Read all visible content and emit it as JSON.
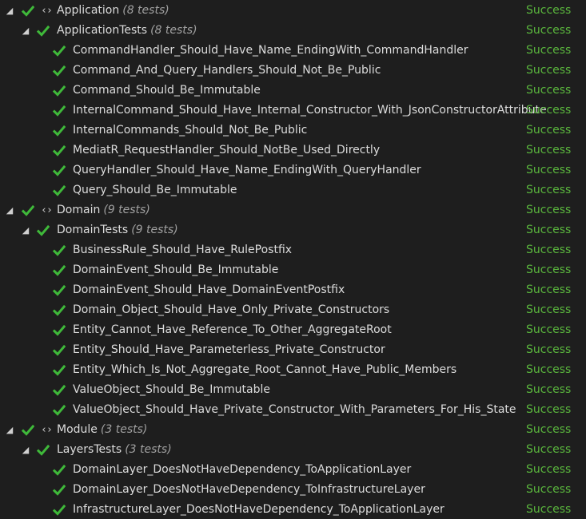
{
  "colors": {
    "background": "#1e1e1e",
    "text": "#dcdcdc",
    "success": "#5ab63d",
    "check_icon": "#3fb93a"
  },
  "icons": {
    "expander": "collapse-triangle-icon",
    "passed": "check-icon",
    "namespace": "namespace-braces-icon"
  },
  "tree": [
    {
      "level": 0,
      "type": "namespace",
      "name": "Application",
      "count": "(8 tests)",
      "status": "Success"
    },
    {
      "level": 1,
      "type": "class",
      "name": "ApplicationTests",
      "count": "(8 tests)",
      "status": "Success"
    },
    {
      "level": 2,
      "type": "test",
      "name": "CommandHandler_Should_Have_Name_EndingWith_CommandHandler",
      "status": "Success"
    },
    {
      "level": 2,
      "type": "test",
      "name": "Command_And_Query_Handlers_Should_Not_Be_Public",
      "status": "Success"
    },
    {
      "level": 2,
      "type": "test",
      "name": "Command_Should_Be_Immutable",
      "status": "Success"
    },
    {
      "level": 2,
      "type": "test",
      "name": "InternalCommand_Should_Have_Internal_Constructor_With_JsonConstructorAttribute",
      "status": "Success"
    },
    {
      "level": 2,
      "type": "test",
      "name": "InternalCommands_Should_Not_Be_Public",
      "status": "Success"
    },
    {
      "level": 2,
      "type": "test",
      "name": "MediatR_RequestHandler_Should_NotBe_Used_Directly",
      "status": "Success"
    },
    {
      "level": 2,
      "type": "test",
      "name": "QueryHandler_Should_Have_Name_EndingWith_QueryHandler",
      "status": "Success"
    },
    {
      "level": 2,
      "type": "test",
      "name": "Query_Should_Be_Immutable",
      "status": "Success"
    },
    {
      "level": 0,
      "type": "namespace",
      "name": "Domain",
      "count": "(9 tests)",
      "status": "Success"
    },
    {
      "level": 1,
      "type": "class",
      "name": "DomainTests",
      "count": "(9 tests)",
      "status": "Success"
    },
    {
      "level": 2,
      "type": "test",
      "name": "BusinessRule_Should_Have_RulePostfix",
      "status": "Success"
    },
    {
      "level": 2,
      "type": "test",
      "name": "DomainEvent_Should_Be_Immutable",
      "status": "Success"
    },
    {
      "level": 2,
      "type": "test",
      "name": "DomainEvent_Should_Have_DomainEventPostfix",
      "status": "Success"
    },
    {
      "level": 2,
      "type": "test",
      "name": "Domain_Object_Should_Have_Only_Private_Constructors",
      "status": "Success"
    },
    {
      "level": 2,
      "type": "test",
      "name": "Entity_Cannot_Have_Reference_To_Other_AggregateRoot",
      "status": "Success"
    },
    {
      "level": 2,
      "type": "test",
      "name": "Entity_Should_Have_Parameterless_Private_Constructor",
      "status": "Success"
    },
    {
      "level": 2,
      "type": "test",
      "name": "Entity_Which_Is_Not_Aggregate_Root_Cannot_Have_Public_Members",
      "status": "Success"
    },
    {
      "level": 2,
      "type": "test",
      "name": "ValueObject_Should_Be_Immutable",
      "status": "Success"
    },
    {
      "level": 2,
      "type": "test",
      "name": "ValueObject_Should_Have_Private_Constructor_With_Parameters_For_His_State",
      "status": "Success"
    },
    {
      "level": 0,
      "type": "namespace",
      "name": "Module",
      "count": "(3 tests)",
      "status": "Success"
    },
    {
      "level": 1,
      "type": "class",
      "name": "LayersTests",
      "count": "(3 tests)",
      "status": "Success"
    },
    {
      "level": 2,
      "type": "test",
      "name": "DomainLayer_DoesNotHaveDependency_ToApplicationLayer",
      "status": "Success"
    },
    {
      "level": 2,
      "type": "test",
      "name": "DomainLayer_DoesNotHaveDependency_ToInfrastructureLayer",
      "status": "Success"
    },
    {
      "level": 2,
      "type": "test",
      "name": "InfrastructureLayer_DoesNotHaveDependency_ToApplicationLayer",
      "status": "Success"
    }
  ]
}
